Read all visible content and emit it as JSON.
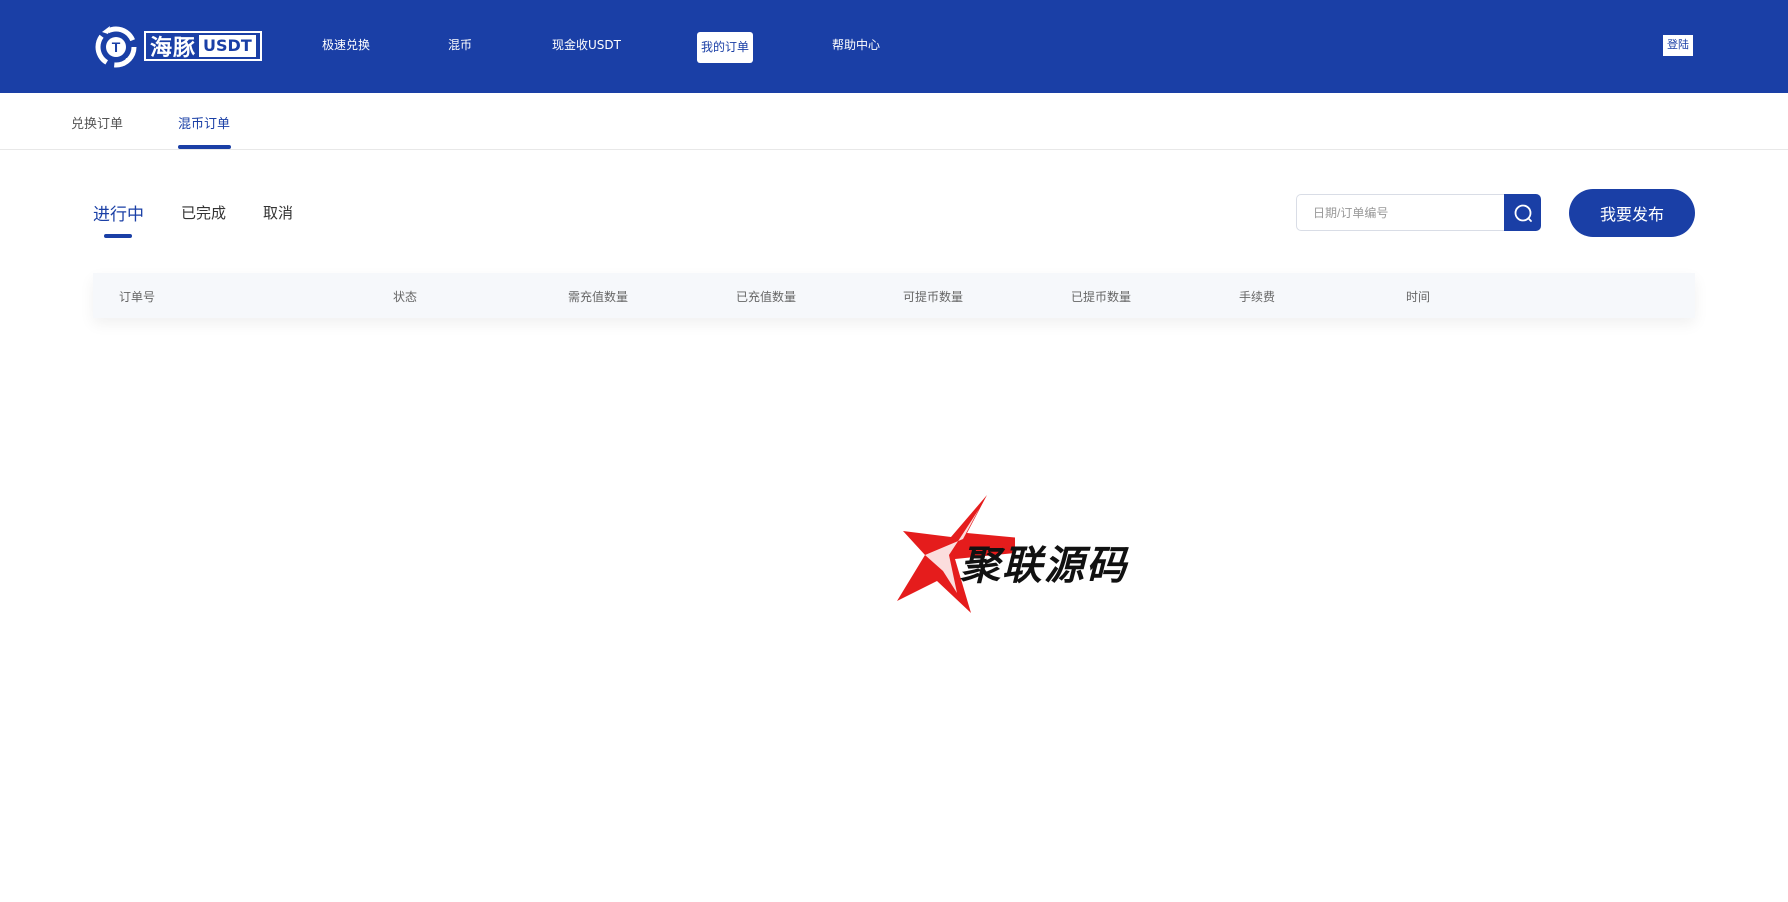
{
  "header": {
    "logo": {
      "cn": "海豚",
      "en": "USDT"
    },
    "nav": [
      {
        "label": "极速兑换"
      },
      {
        "label": "混币"
      },
      {
        "label": "现金收USDT"
      },
      {
        "label": "我的订单"
      },
      {
        "label": "帮助中心"
      }
    ],
    "active_nav": "我的订单",
    "login_label": "登陆"
  },
  "subtabs": {
    "items": [
      {
        "label": "兑换订单"
      },
      {
        "label": "混币订单"
      }
    ],
    "active": "混币订单"
  },
  "status_tabs": {
    "items": [
      {
        "label": "进行中"
      },
      {
        "label": "已完成"
      },
      {
        "label": "取消"
      }
    ],
    "active": "进行中"
  },
  "search": {
    "placeholder": "日期/订单编号",
    "value": "",
    "icon": "search-icon"
  },
  "publish_label": "我要发布",
  "table": {
    "columns": [
      "订单号",
      "状态",
      "需充值数量",
      "已充值数量",
      "可提币数量",
      "已提币数量",
      "手续费",
      "时间"
    ],
    "rows": []
  },
  "watermark": {
    "text": "聚联源码"
  },
  "colors": {
    "primary": "#1a3fa6",
    "table_header_bg": "#f6f8fb",
    "watermark_red": "#e51c1c"
  }
}
